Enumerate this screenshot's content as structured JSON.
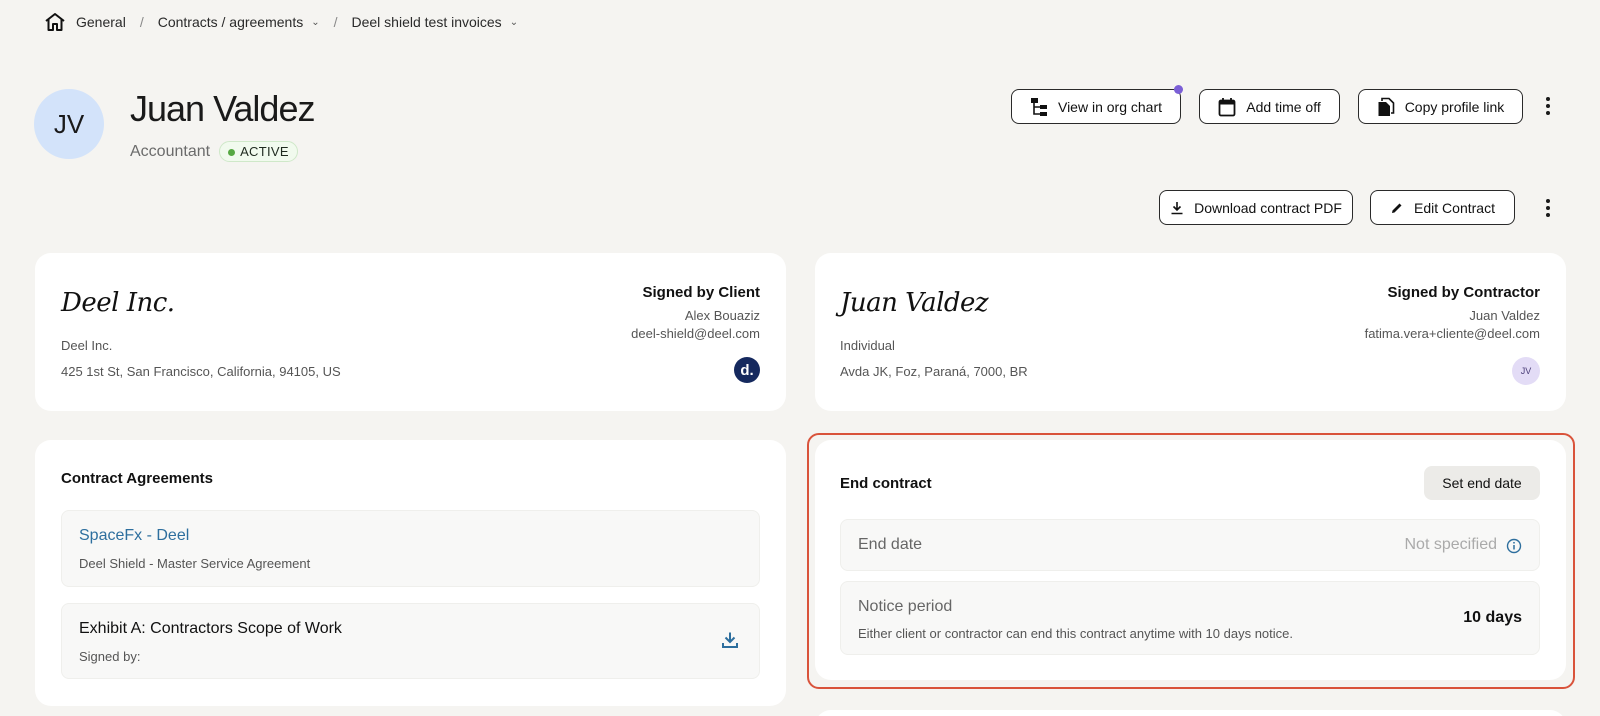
{
  "breadcrumb": {
    "home_icon": "home-icon",
    "items": [
      "General",
      "Contracts / agreements",
      "Deel shield test invoices"
    ]
  },
  "profile": {
    "initials": "JV",
    "name": "Juan Valdez",
    "role": "Accountant",
    "status": "ACTIVE"
  },
  "header_actions": {
    "org_chart": "View in org chart",
    "time_off": "Add time off",
    "copy_link": "Copy profile link"
  },
  "contract_actions": {
    "download_pdf": "Download contract PDF",
    "edit": "Edit Contract"
  },
  "client_card": {
    "signature": "Deel Inc.",
    "entity": "Deel Inc.",
    "address": "425 1st St, San Francisco, California, 94105, US",
    "signed_label": "Signed by Client",
    "signer_name": "Alex Bouaziz",
    "signer_email": "deel-shield@deel.com",
    "logo_text": "d."
  },
  "contractor_card": {
    "signature": "Juan Valdez",
    "entity": "Individual",
    "address": "Avda JK, Foz, Paraná, 7000, BR",
    "signed_label": "Signed by Contractor",
    "signer_name": "Juan Valdez",
    "signer_email": "fatima.vera+cliente@deel.com",
    "avatar_text": "JV"
  },
  "agreements": {
    "title": "Contract Agreements",
    "items": [
      {
        "title": "SpaceFx - Deel",
        "subtitle": "Deel Shield - Master Service Agreement"
      },
      {
        "title": "Exhibit A: Contractors Scope of Work",
        "subtitle": "Signed by:"
      }
    ]
  },
  "end_contract": {
    "title": "End contract",
    "set_end_date": "Set end date",
    "end_date_label": "End date",
    "end_date_value": "Not specified",
    "notice_label": "Notice period",
    "notice_desc": "Either client or contractor can end this contract anytime with 10 days notice.",
    "notice_value": "10 days"
  },
  "colors": {
    "background": "#f5f4f1",
    "link": "#2e6f9e",
    "highlight": "#d9533b",
    "active_dot": "#56a843",
    "notification": "#7b5fd6"
  }
}
